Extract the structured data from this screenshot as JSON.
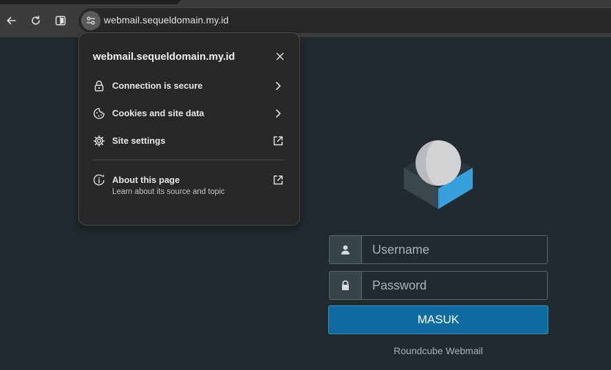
{
  "browser": {
    "url": "webmail.sequeldomain.my.id",
    "icons": {
      "back": "arrow-left-icon",
      "reload": "reload-icon",
      "split": "split-view-icon",
      "site_info": "tune-icon"
    }
  },
  "popup": {
    "title": "webmail.sequeldomain.my.id",
    "items": [
      {
        "label": "Connection is secure",
        "icon": "lock-icon",
        "trail": "chevron-right-icon"
      },
      {
        "label": "Cookies and site data",
        "icon": "cookie-icon",
        "trail": "chevron-right-icon"
      },
      {
        "label": "Site settings",
        "icon": "gear-icon",
        "trail": "external-link-icon"
      }
    ],
    "about": {
      "label": "About this page",
      "sublabel": "Learn about its source and topic",
      "icon": "info-sparkle-icon",
      "trail": "external-link-icon"
    }
  },
  "login": {
    "username_placeholder": "Username",
    "password_placeholder": "Password",
    "submit_label": "MASUK",
    "footer": "Roundcube Webmail",
    "colors": {
      "accent": "#0f6ca0",
      "logo_blue": "#37a0dc",
      "background": "#212a2f"
    }
  }
}
